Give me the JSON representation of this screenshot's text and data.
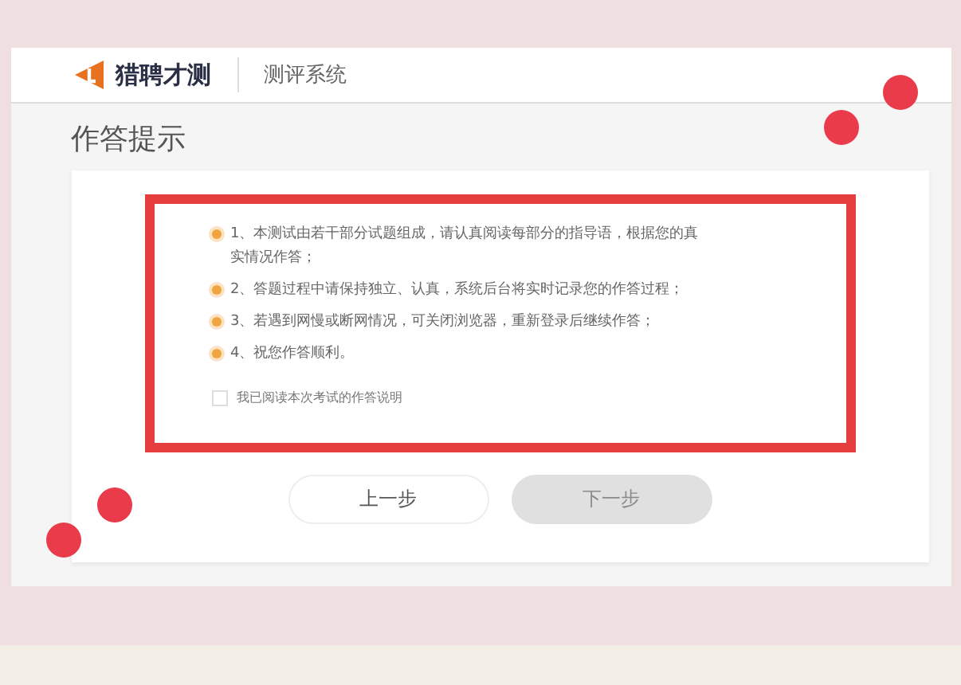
{
  "header": {
    "logo_text": "猎聘才测",
    "system_name": "测评系统"
  },
  "page_title": "作答提示",
  "instructions": [
    {
      "text": "1、本测试由若干部分试题组成，请认真阅读每部分的指导语，根据您的真实情况作答；"
    },
    {
      "text": "2、答题过程中请保持独立、认真，系统后台将实时记录您的作答过程；"
    },
    {
      "text": "3、若遇到网慢或断网情况，可关闭浏览器，重新登录后继续作答；"
    },
    {
      "text": "4、祝您作答顺利。"
    }
  ],
  "agreement": {
    "label": "我已阅读本次考试的作答说明",
    "checked": false
  },
  "buttons": [
    {
      "label": "上一步",
      "kind": "secondary",
      "disabled": false
    },
    {
      "label": "下一步",
      "kind": "primary",
      "disabled": true
    }
  ]
}
